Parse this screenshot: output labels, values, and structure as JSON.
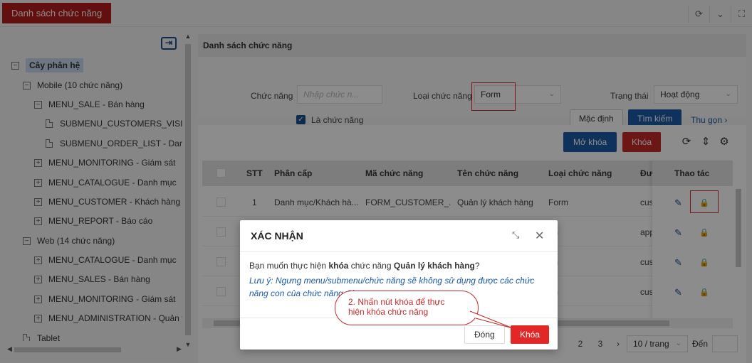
{
  "topbar": {
    "tab_label": "Danh sách chức năng",
    "icons": [
      "refresh-icon",
      "chevron-down-icon",
      "fullscreen-icon"
    ]
  },
  "tree": {
    "root": "Cây phân hệ",
    "nodes": [
      "Mobile (10 chức năng)",
      "MENU_SALE - Bán hàng",
      "SUBMENU_CUSTOMERS_VISIT - I",
      "SUBMENU_ORDER_LIST - Danh s",
      "MENU_MONITORING - Giám sát",
      "MENU_CATALOGUE - Danh mục",
      "MENU_CUSTOMER - Khách hàng",
      "MENU_REPORT - Báo cáo",
      "Web (14 chức năng)",
      "MENU_CATALOGUE - Danh mục",
      "MENU_SALES - Bán hàng",
      "MENU_MONITORING - Giám sát",
      "MENU_ADMINISTRATION - Quản tr",
      "Tablet"
    ]
  },
  "filter": {
    "title": "Danh sách chức năng",
    "function_label": "Chức năng",
    "function_placeholder": "Nhập chức n...",
    "type_label": "Loại chức năng",
    "type_value": "Form",
    "status_label": "Trạng thái",
    "status_value": "Hoạt động",
    "is_function_label": "Là chức năng",
    "default_button": "Mặc định",
    "search_button": "Tìm kiếm",
    "collapse_link": "Thu gọn"
  },
  "grid": {
    "unlock_button": "Mở khóa",
    "lock_button": "Khóa",
    "headers": [
      "STT",
      "Phân cấp",
      "Mã chức năng",
      "Tên chức năng",
      "Loại chức năng",
      "Đư",
      "Thao tác"
    ],
    "rows": [
      {
        "stt": "1",
        "level": "Danh mục/Khách hà...",
        "code": "FORM_CUSTOMER_...",
        "name": "Quản lý khách hàng",
        "type": "Form",
        "path": "cus"
      },
      {
        "stt": "",
        "level": "",
        "code": "",
        "name": "",
        "type": "rm",
        "path": "app"
      },
      {
        "stt": "",
        "level": "",
        "code": "",
        "name": "",
        "type": "rm",
        "path": "cus"
      },
      {
        "stt": "",
        "level": "",
        "code": "",
        "name": "",
        "type": "rm",
        "path": "cus"
      }
    ],
    "pager": {
      "pages": [
        "2",
        "3"
      ],
      "page_size": "10 / trang",
      "goto_label": "Đến"
    }
  },
  "modal": {
    "title": "XÁC NHẬN",
    "msg_prefix": "Bạn muốn thực hiện ",
    "msg_action": "khóa",
    "msg_middle": " chức năng ",
    "msg_name": "Quản lý khách hàng",
    "msg_suffix": "?",
    "note": "Lưu ý: Ngưng menu/submenu/chức năng sẽ không sử dụng được các chức năng con của chức năng đó.",
    "close_button": "Đóng",
    "confirm_button": "Khóa"
  },
  "callout": {
    "line1": "2. Nhấn nút khóa để thực",
    "line2": "hiện khóa chức năng"
  },
  "colors": {
    "brand_red": "#b71c1c",
    "primary_blue": "#1a5ca8",
    "danger_red": "#e32727"
  }
}
